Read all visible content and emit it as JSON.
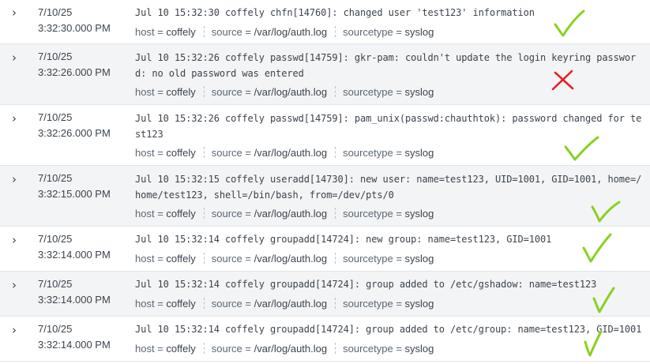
{
  "labels": {
    "host": "host",
    "source": "source",
    "sourcetype": "sourcetype",
    "eq": " = "
  },
  "events": [
    {
      "date": "7/10/25",
      "time": "3:32:30.000 PM",
      "raw": "Jul 10 15:32:30 coffely chfn[14760]: changed user 'test123' information",
      "host": "coffely",
      "source": "/var/log/auth.log",
      "sourcetype": "syslog",
      "annotation": "check"
    },
    {
      "date": "7/10/25",
      "time": "3:32:26.000 PM",
      "raw": "Jul 10 15:32:26 coffely passwd[14759]: gkr-pam: couldn't update the login keyring password: no old password was entered",
      "host": "coffely",
      "source": "/var/log/auth.log",
      "sourcetype": "syslog",
      "annotation": "cross"
    },
    {
      "date": "7/10/25",
      "time": "3:32:26.000 PM",
      "raw": "Jul 10 15:32:26 coffely passwd[14759]: pam_unix(passwd:chauthtok): password changed for test123",
      "host": "coffely",
      "source": "/var/log/auth.log",
      "sourcetype": "syslog",
      "annotation": "check"
    },
    {
      "date": "7/10/25",
      "time": "3:32:15.000 PM",
      "raw": "Jul 10 15:32:15 coffely useradd[14730]: new user: name=test123, UID=1001, GID=1001, home=/home/test123, shell=/bin/bash, from=/dev/pts/0",
      "host": "coffely",
      "source": "/var/log/auth.log",
      "sourcetype": "syslog",
      "annotation": "check"
    },
    {
      "date": "7/10/25",
      "time": "3:32:14.000 PM",
      "raw": "Jul 10 15:32:14 coffely groupadd[14724]: new group: name=test123, GID=1001",
      "host": "coffely",
      "source": "/var/log/auth.log",
      "sourcetype": "syslog",
      "annotation": "check"
    },
    {
      "date": "7/10/25",
      "time": "3:32:14.000 PM",
      "raw": "Jul 10 15:32:14 coffely groupadd[14724]: group added to /etc/gshadow: name=test123",
      "host": "coffely",
      "source": "/var/log/auth.log",
      "sourcetype": "syslog",
      "annotation": "check"
    },
    {
      "date": "7/10/25",
      "time": "3:32:14.000 PM",
      "raw": "Jul 10 15:32:14 coffely groupadd[14724]: group added to /etc/group: name=test123, GID=1001",
      "host": "coffely",
      "source": "/var/log/auth.log",
      "sourcetype": "syslog",
      "annotation": "check"
    }
  ],
  "colors": {
    "check": "#8ad11f",
    "cross": "#e8202a"
  }
}
